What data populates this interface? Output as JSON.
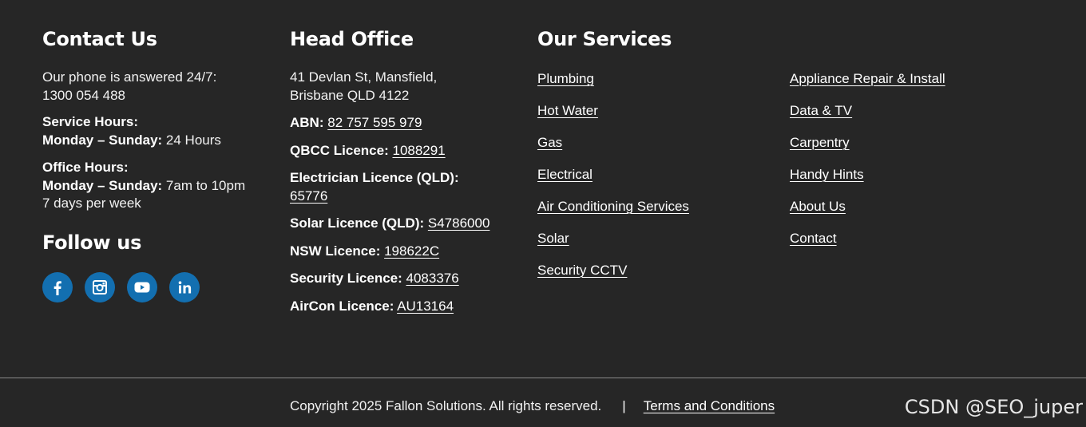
{
  "contact": {
    "heading": "Contact Us",
    "phone_intro": "Our phone is answered 24/7:",
    "phone": "1300 054 488",
    "service_hours_label": "Service Hours:",
    "service_days": "Monday – Sunday:",
    "service_hours_value": " 24 Hours",
    "office_hours_label": "Office Hours:",
    "office_days": "Monday – Sunday:",
    "office_hours_value": " 7am to 10pm",
    "office_week": "7 days per week"
  },
  "follow": {
    "heading": "Follow us",
    "icons": [
      "facebook-icon",
      "instagram-icon",
      "youtube-icon",
      "linkedin-icon"
    ],
    "icon_bg": "#136fb0"
  },
  "office": {
    "heading": "Head Office",
    "address_line1": "41 Devlan St, Mansfield,",
    "address_line2": "Brisbane QLD 4122",
    "licences": [
      {
        "label": "ABN:",
        "value": "82 757 595 979"
      },
      {
        "label": "QBCC Licence:",
        "value": "1088291"
      },
      {
        "label": "Electrician Licence (QLD):",
        "value": "65776"
      },
      {
        "label": "Solar Licence (QLD):",
        "value": "S4786000"
      },
      {
        "label": "NSW Licence:",
        "value": "198622C"
      },
      {
        "label": "Security Licence:",
        "value": "4083376"
      },
      {
        "label": "AirCon Licence:",
        "value": "AU13164"
      }
    ]
  },
  "services": {
    "heading": "Our Services",
    "col1": [
      "Plumbing",
      "Hot Water",
      "Gas",
      "Electrical",
      "Air Conditioning Services",
      "Solar",
      "Security CCTV"
    ],
    "col2": [
      "Appliance Repair & Install",
      "Data & TV",
      "Carpentry",
      "Handy Hints",
      "About Us",
      "Contact"
    ]
  },
  "footer": {
    "copyright": "Copyright 2025 Fallon Solutions. All rights reserved.",
    "separator": "|",
    "terms": "Terms and Conditions"
  },
  "watermark": "CSDN @SEO_juper",
  "colors": {
    "background": "#262626",
    "text": "#ffffff",
    "accent": "#136fb0"
  }
}
